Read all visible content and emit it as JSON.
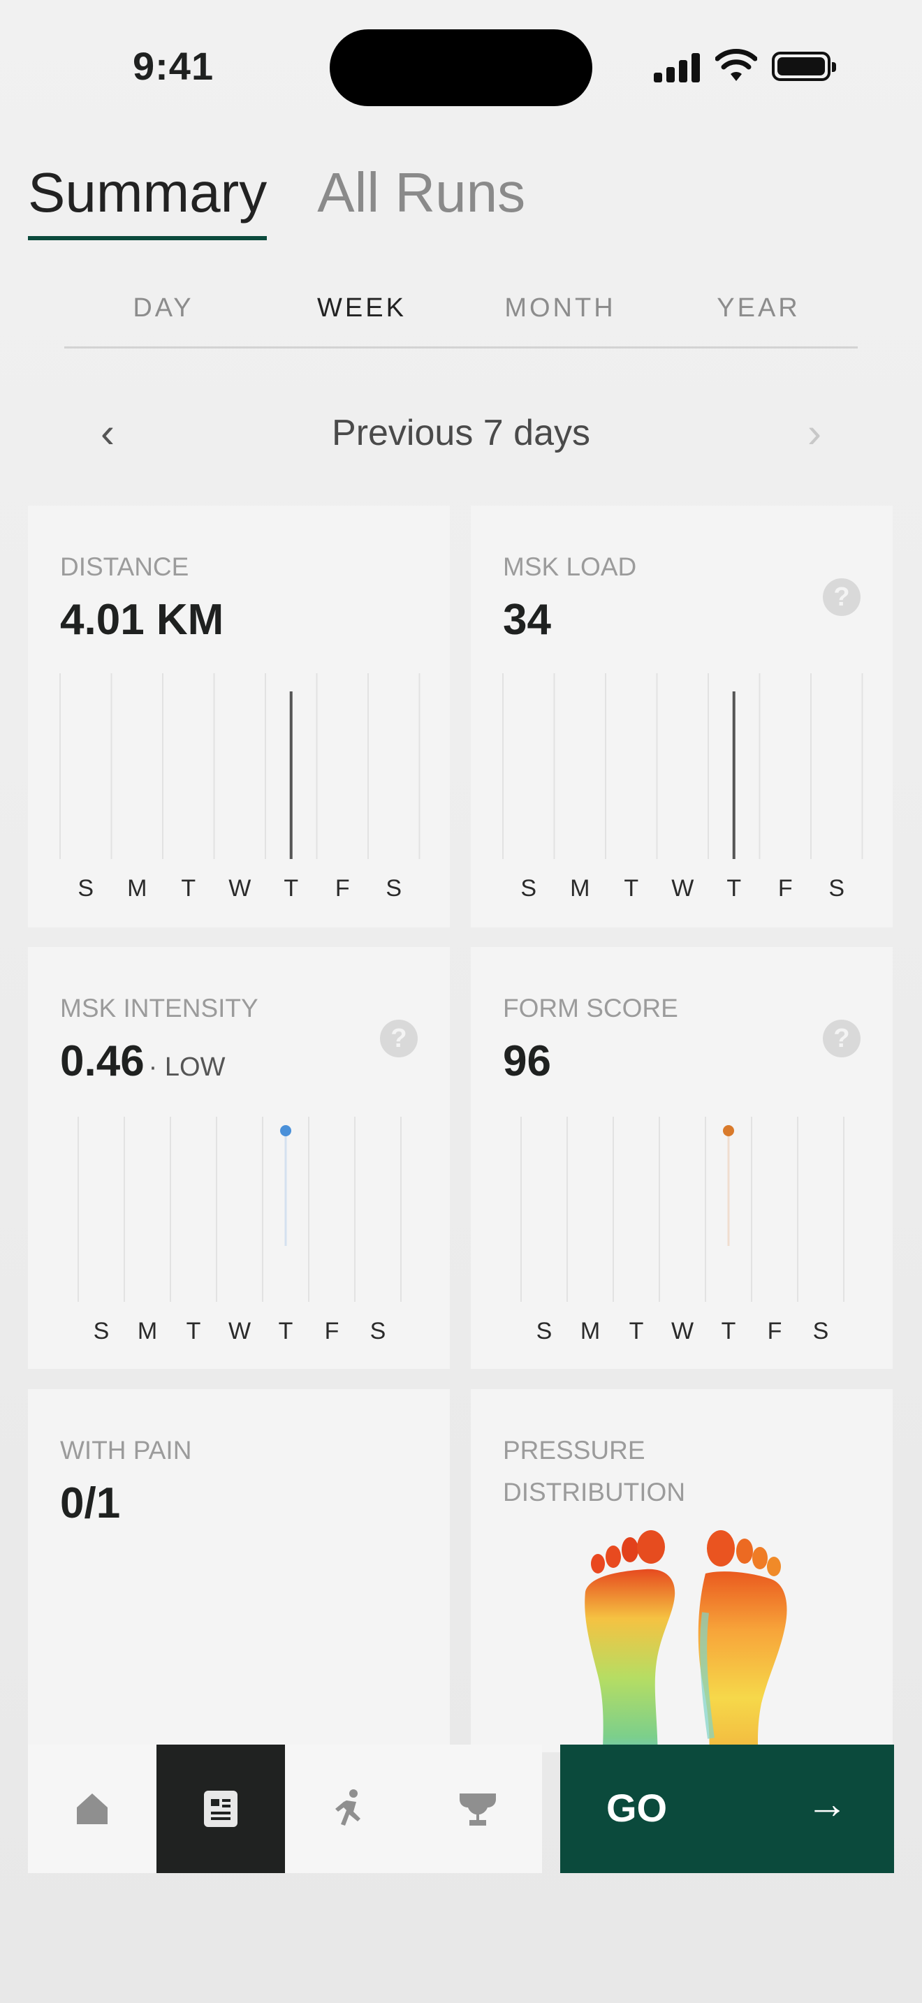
{
  "status_bar": {
    "time": "9:41"
  },
  "tabs": [
    {
      "label": "Summary",
      "active": true
    },
    {
      "label": "All Runs",
      "active": false
    }
  ],
  "periods": [
    {
      "label": "DAY",
      "active": false
    },
    {
      "label": "WEEK",
      "active": true
    },
    {
      "label": "MONTH",
      "active": false
    },
    {
      "label": "YEAR",
      "active": false
    }
  ],
  "range_nav": {
    "label": "Previous 7 days",
    "prev_icon": "chevron-left-icon",
    "next_icon": "chevron-right-icon"
  },
  "cards": {
    "distance": {
      "title": "DISTANCE",
      "value": "4.01 KM"
    },
    "msk_load": {
      "title": "MSK LOAD",
      "value": "34",
      "help_icon": "question-icon"
    },
    "msk_intensity": {
      "title": "MSK INTENSITY",
      "value": "0.46",
      "sub": "· LOW",
      "help_icon": "question-icon"
    },
    "form_score": {
      "title": "FORM SCORE",
      "value": "96",
      "help_icon": "question-icon"
    },
    "with_pain": {
      "title": "WITH PAIN",
      "value": "0/1"
    },
    "pressure": {
      "title_line1": "PRESSURE",
      "title_line2": "DISTRIBUTION"
    }
  },
  "chart_data": [
    {
      "type": "bar",
      "name": "distance",
      "categories": [
        "S",
        "M",
        "T",
        "W",
        "T",
        "F",
        "S"
      ],
      "values": [
        0,
        0,
        0,
        0,
        4.01,
        0,
        0
      ]
    },
    {
      "type": "bar",
      "name": "msk_load",
      "categories": [
        "S",
        "M",
        "T",
        "W",
        "T",
        "F",
        "S"
      ],
      "values": [
        0,
        0,
        0,
        0,
        34,
        0,
        0
      ]
    },
    {
      "type": "scatter",
      "name": "msk_intensity",
      "categories": [
        "S",
        "M",
        "T",
        "W",
        "T",
        "F",
        "S"
      ],
      "values": [
        null,
        null,
        null,
        null,
        0.46,
        null,
        null
      ],
      "color": "#4a90d9"
    },
    {
      "type": "scatter",
      "name": "form_score",
      "categories": [
        "S",
        "M",
        "T",
        "W",
        "T",
        "F",
        "S"
      ],
      "values": [
        null,
        null,
        null,
        null,
        96,
        null,
        null
      ],
      "color": "#d97a2b"
    }
  ],
  "bottom_nav": {
    "items": [
      {
        "icon": "home-icon",
        "active": false
      },
      {
        "icon": "summary-icon",
        "active": true
      },
      {
        "icon": "run-icon",
        "active": false
      },
      {
        "icon": "trophy-icon",
        "active": false
      }
    ],
    "go_label": "GO",
    "go_icon": "arrow-right-icon"
  },
  "colors": {
    "accent": "#0b4a3c",
    "active_tab_bg": "#202221",
    "intensity_dot": "#4a90d9",
    "form_dot": "#d97a2b"
  }
}
